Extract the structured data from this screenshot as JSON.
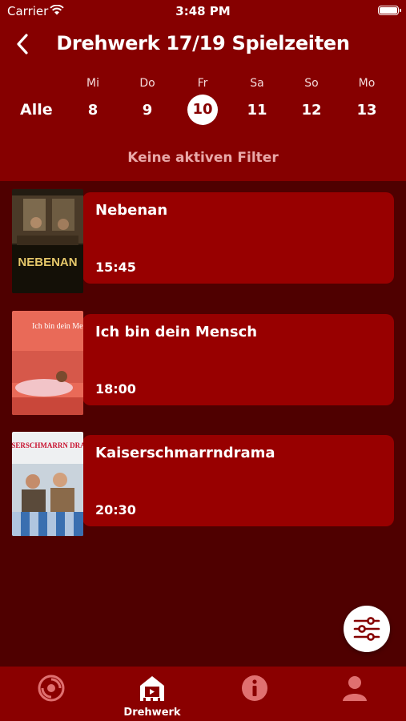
{
  "status": {
    "carrier": "Carrier",
    "time": "3:48 PM"
  },
  "nav": {
    "title": "Drehwerk 17/19 Spielzeiten"
  },
  "days": {
    "all_label": "Alle",
    "items": [
      {
        "name": "Mi",
        "num": "8"
      },
      {
        "name": "Do",
        "num": "9"
      },
      {
        "name": "Fr",
        "num": "10"
      },
      {
        "name": "Sa",
        "num": "11"
      },
      {
        "name": "So",
        "num": "12"
      },
      {
        "name": "Mo",
        "num": "13"
      }
    ],
    "selected": "10"
  },
  "filter_text": "Keine aktiven Filter",
  "movies": [
    {
      "title": "Nebenan",
      "time": "15:45",
      "poster_text": "NEBENAN"
    },
    {
      "title": "Ich bin dein Mensch",
      "time": "18:00",
      "poster_text": "Ich bin dein Mensch"
    },
    {
      "title": "Kaiserschmarrndrama",
      "time": "20:30",
      "poster_text": "KAISERSCHMARRN DRAMA"
    }
  ],
  "tabs": [
    {
      "icon": "spiral-logo-icon",
      "label": ""
    },
    {
      "icon": "cinema-house-icon",
      "label": "Drehwerk"
    },
    {
      "icon": "info-icon",
      "label": ""
    },
    {
      "icon": "profile-icon",
      "label": ""
    }
  ],
  "colors": {
    "header": "#860000",
    "background": "#4f0000",
    "card": "#980000",
    "tabbar": "#8a0000"
  }
}
